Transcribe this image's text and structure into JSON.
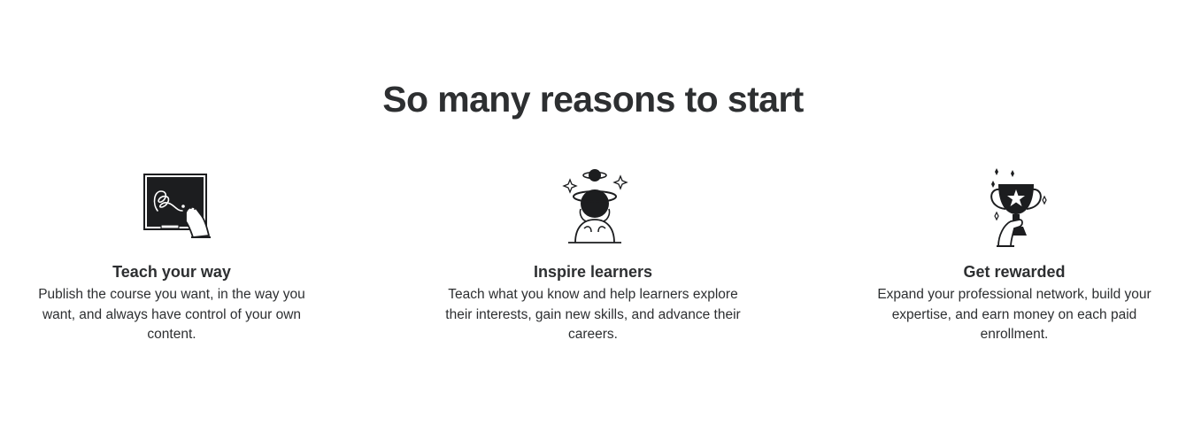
{
  "section": {
    "title": "So many reasons to start"
  },
  "reasons": [
    {
      "icon": "chalkboard-hand-icon",
      "heading": "Teach your way",
      "text": "Publish the course you want, in the way you want, and always have control of your own content."
    },
    {
      "icon": "planet-head-person-icon",
      "heading": "Inspire learners",
      "text": "Teach what you know and help learners explore their interests, gain new skills, and advance their careers."
    },
    {
      "icon": "trophy-hand-icon",
      "heading": "Get rewarded",
      "text": "Expand your professional network, build your expertise, and earn money on each paid enrollment."
    }
  ],
  "colors": {
    "text": "#2d2f31",
    "ink": "#1c1d1f",
    "background": "#ffffff"
  }
}
